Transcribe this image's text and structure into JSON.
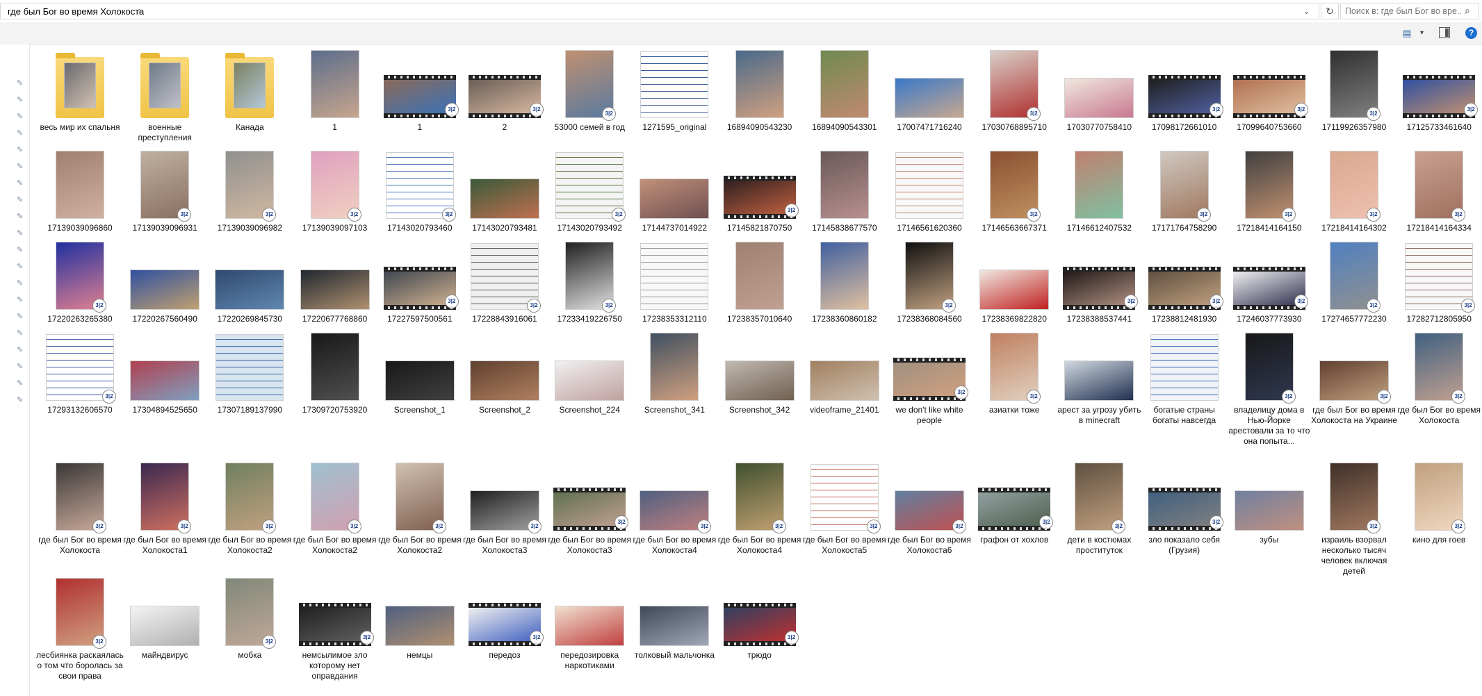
{
  "address_bar": {
    "path": "где был Бог во время Холокоста",
    "chevron": "›",
    "dropdown_icon": "chevron-down-icon",
    "refresh_icon": "refresh-icon"
  },
  "search": {
    "placeholder": "Поиск в: где был Бог во вре...",
    "icon": "search-icon"
  },
  "ribbon": {
    "view_options_icon": "view-options-icon",
    "preview_pane_icon": "preview-pane-icon",
    "help_label": "?"
  },
  "nav": {
    "pin_icon": "pin-icon",
    "pin_count": 20
  },
  "badge_text": "3|2",
  "colors": {
    "folder": "#f0c447",
    "search_border": "#d9d9d9",
    "help": "#1a6fd0"
  },
  "rows": [
    {
      "items": [
        {
          "label": "весь мир их спальня",
          "kind": "folder",
          "c1": "#6a6a70",
          "c2": "#d2c2b2"
        },
        {
          "label": "военные преступления",
          "kind": "folder",
          "c1": "#707a88",
          "c2": "#c0c0c8"
        },
        {
          "label": "Канада",
          "kind": "folder",
          "c1": "#7a8060",
          "c2": "#b4c8d8"
        },
        {
          "label": "1",
          "kind": "portrait",
          "c1": "#5d6e8c",
          "c2": "#c7a58d"
        },
        {
          "label": "1",
          "kind": "video",
          "c1": "#8a6a5a",
          "c2": "#3a72b8",
          "badge": true
        },
        {
          "label": "2",
          "kind": "video",
          "c1": "#6a5e56",
          "c2": "#d8b8a0",
          "badge": true
        },
        {
          "label": "53000 семей в год",
          "kind": "portrait",
          "c1": "#c09070",
          "c2": "#5a7aa0",
          "badge": true
        },
        {
          "label": "1271595_original",
          "kind": "doc",
          "c1": "#ffffff",
          "c2": "#3c5f9a"
        },
        {
          "label": "16894090543230",
          "kind": "portrait",
          "c1": "#4a6a8a",
          "c2": "#d0a080"
        },
        {
          "label": "16894090543301",
          "kind": "portrait",
          "c1": "#708a50",
          "c2": "#c08a70"
        },
        {
          "label": "17007471716240",
          "kind": "landscape",
          "c1": "#3a78c8",
          "c2": "#c8a890"
        },
        {
          "label": "17030768895710",
          "kind": "portrait",
          "c1": "#d8d0c8",
          "c2": "#b03030",
          "badge": true
        },
        {
          "label": "17030770758410",
          "kind": "landscape",
          "c1": "#f0e8e0",
          "c2": "#c87890"
        },
        {
          "label": "17098172661010",
          "kind": "video",
          "c1": "#202020",
          "c2": "#5060a0",
          "badge": true
        },
        {
          "label": "17099640753660",
          "kind": "video",
          "c1": "#b07050",
          "c2": "#e0c0a0",
          "badge": true
        },
        {
          "label": "17119926357980",
          "kind": "portrait",
          "c1": "#303030",
          "c2": "#808080",
          "badge": true
        },
        {
          "label": "17125733461640",
          "kind": "video",
          "c1": "#3050a0",
          "c2": "#c09070",
          "badge": true
        }
      ]
    },
    {
      "items": [
        {
          "label": "17139039096860",
          "kind": "portrait",
          "c1": "#a08070",
          "c2": "#d0b0a0"
        },
        {
          "label": "17139039096931",
          "kind": "portrait",
          "c1": "#c0b0a0",
          "c2": "#8a7060",
          "badge": true
        },
        {
          "label": "17139039096982",
          "kind": "portrait",
          "c1": "#909090",
          "c2": "#d0b8a0",
          "badge": true
        },
        {
          "label": "17139039097103",
          "kind": "portrait",
          "c1": "#e0a0c0",
          "c2": "#f0d0c0",
          "badge": true
        },
        {
          "label": "17143020793460",
          "kind": "doc",
          "c1": "#ffffff",
          "c2": "#4070c0",
          "badge": true
        },
        {
          "label": "17143020793481",
          "kind": "landscape",
          "c1": "#3a5a3a",
          "c2": "#c07050"
        },
        {
          "label": "17143020793492",
          "kind": "doc",
          "c1": "#f4f4f4",
          "c2": "#507030",
          "badge": true
        },
        {
          "label": "17144737014922",
          "kind": "landscape",
          "c1": "#c0907a",
          "c2": "#705050"
        },
        {
          "label": "17145821870750",
          "kind": "video",
          "c1": "#302020",
          "c2": "#c06040",
          "badge": true
        },
        {
          "label": "17145838677570",
          "kind": "portrait",
          "c1": "#6a5858",
          "c2": "#b89090"
        },
        {
          "label": "17146561620360",
          "kind": "doc",
          "c1": "#f8f8f8",
          "c2": "#c08060"
        },
        {
          "label": "17146563667371",
          "kind": "portrait",
          "c1": "#8a5030",
          "c2": "#c09060",
          "badge": true
        },
        {
          "label": "17146612407532",
          "kind": "portrait",
          "c1": "#c08070",
          "c2": "#80c0a0"
        },
        {
          "label": "17171764758290",
          "kind": "portrait",
          "c1": "#d0c8c0",
          "c2": "#a07860",
          "badge": true
        },
        {
          "label": "17218414164150",
          "kind": "portrait",
          "c1": "#404040",
          "c2": "#c09070",
          "badge": true
        },
        {
          "label": "17218414164302",
          "kind": "portrait",
          "c1": "#d8a890",
          "c2": "#f0c0b0",
          "badge": true
        },
        {
          "label": "17218414164334",
          "kind": "portrait",
          "c1": "#c8a090",
          "c2": "#a07060",
          "badge": true
        }
      ]
    },
    {
      "items": [
        {
          "label": "17220263265380",
          "kind": "portrait",
          "c1": "#2030a0",
          "c2": "#e08090",
          "badge": true
        },
        {
          "label": "17220267560490",
          "kind": "landscape",
          "c1": "#3050a0",
          "c2": "#c0a070"
        },
        {
          "label": "17220269845730",
          "kind": "landscape",
          "c1": "#304870",
          "c2": "#6088b0"
        },
        {
          "label": "17220677768860",
          "kind": "landscape",
          "c1": "#202830",
          "c2": "#b09070"
        },
        {
          "label": "17227597500561",
          "kind": "video",
          "c1": "#404850",
          "c2": "#d0b090",
          "badge": true
        },
        {
          "label": "17228843916061",
          "kind": "doc",
          "c1": "#f0f0f0",
          "c2": "#505050",
          "badge": true
        },
        {
          "label": "17233419226750",
          "kind": "portrait",
          "c1": "#202020",
          "c2": "#e0e0e0",
          "badge": true
        },
        {
          "label": "17238353312110",
          "kind": "doc",
          "c1": "#f8f8f8",
          "c2": "#909090"
        },
        {
          "label": "17238357010640",
          "kind": "portrait",
          "c1": "#a08070",
          "c2": "#c0a090"
        },
        {
          "label": "17238360860182",
          "kind": "portrait",
          "c1": "#4060a0",
          "c2": "#e0c0a0"
        },
        {
          "label": "17238368084560",
          "kind": "portrait",
          "c1": "#101010",
          "c2": "#c0a080",
          "badge": true
        },
        {
          "label": "17238369822820",
          "kind": "landscape",
          "c1": "#f0e8e0",
          "c2": "#c02020"
        },
        {
          "label": "17238388537441",
          "kind": "video",
          "c1": "#201818",
          "c2": "#b09080",
          "badge": true
        },
        {
          "label": "17238812481930",
          "kind": "video",
          "c1": "#605040",
          "c2": "#c0a080",
          "badge": true
        },
        {
          "label": "17246037773930",
          "kind": "video",
          "c1": "#f0f0f0",
          "c2": "#303050",
          "badge": true
        },
        {
          "label": "17274657772230",
          "kind": "portrait",
          "c1": "#5080c0",
          "c2": "#909090",
          "badge": true
        },
        {
          "label": "17282712805950",
          "kind": "doc",
          "c1": "#f8f8f8",
          "c2": "#806050",
          "badge": true
        }
      ]
    },
    {
      "items": [
        {
          "label": "17293132606570",
          "kind": "doc",
          "c1": "#ffffff",
          "c2": "#3050a0",
          "badge": true
        },
        {
          "label": "17304894525650",
          "kind": "landscape",
          "c1": "#b04050",
          "c2": "#80a0c0"
        },
        {
          "label": "17307189137990",
          "kind": "doc",
          "c1": "#d8e4f0",
          "c2": "#3060a0"
        },
        {
          "label": "17309720753920",
          "kind": "portrait",
          "c1": "#181818",
          "c2": "#505050"
        },
        {
          "label": "Screenshot_1",
          "kind": "landscape",
          "c1": "#181818",
          "c2": "#404040"
        },
        {
          "label": "Screenshot_2",
          "kind": "landscape",
          "c1": "#604030",
          "c2": "#b08060"
        },
        {
          "label": "Screenshot_224",
          "kind": "landscape",
          "c1": "#f0f0f0",
          "c2": "#c0a0a0"
        },
        {
          "label": "Screenshot_341",
          "kind": "portrait",
          "c1": "#405060",
          "c2": "#d0a080"
        },
        {
          "label": "Screenshot_342",
          "kind": "landscape",
          "c1": "#c0b8b0",
          "c2": "#706050"
        },
        {
          "label": "videoframe_21401",
          "kind": "landscape",
          "c1": "#a08060",
          "c2": "#d0c0b0"
        },
        {
          "label": "we don't like white people",
          "kind": "video",
          "c1": "#a09080",
          "c2": "#d0a080",
          "badge": true
        },
        {
          "label": "азиатки тоже",
          "kind": "portrait",
          "c1": "#c08060",
          "c2": "#e0d0c0",
          "badge": true
        },
        {
          "label": "арест за угрозу убить в minecraft",
          "kind": "landscape",
          "c1": "#d0d8e0",
          "c2": "#203050"
        },
        {
          "label": "богатые страны богаты навсегда",
          "kind": "doc",
          "c1": "#f0f4f8",
          "c2": "#3060b0"
        },
        {
          "label": "владелицу дома в Нью-Йорке арестовали за то что она попыта...",
          "kind": "portrait",
          "c1": "#181818",
          "c2": "#303850",
          "badge": true
        },
        {
          "label": "где был Бог во время Холокоста на Украине",
          "kind": "landscape",
          "c1": "#604030",
          "c2": "#c0a080",
          "badge": true
        },
        {
          "label": "где был Бог во время Холокоста",
          "kind": "portrait",
          "c1": "#406080",
          "c2": "#c0a090",
          "badge": true
        }
      ]
    },
    {
      "items": [
        {
          "label": "где был Бог во время Холокоста",
          "kind": "portrait",
          "c1": "#3a3838",
          "c2": "#c8a898",
          "badge": true
        },
        {
          "label": "где был Бог во время Холокоста1",
          "kind": "portrait",
          "c1": "#3a2850",
          "c2": "#d07060",
          "badge": true
        },
        {
          "label": "где был Бог во время Холокоста2",
          "kind": "portrait",
          "c1": "#708060",
          "c2": "#c0a080",
          "badge": true
        },
        {
          "label": "где был Бог во время Холокоста2",
          "kind": "portrait",
          "c1": "#a0c0d0",
          "c2": "#d0a0b0",
          "badge": true
        },
        {
          "label": "где был Бог во время Холокоста2",
          "kind": "portrait",
          "c1": "#d0c0b0",
          "c2": "#806050",
          "badge": true
        },
        {
          "label": "где был Бог во время Холокоста3",
          "kind": "landscape",
          "c1": "#202020",
          "c2": "#a0a0a0",
          "badge": true
        },
        {
          "label": "где был Бог во время Холокоста3",
          "kind": "video",
          "c1": "#607050",
          "c2": "#c0a090",
          "badge": true
        },
        {
          "label": "где был Бог во время Холокоста4",
          "kind": "landscape",
          "c1": "#506080",
          "c2": "#c08080",
          "badge": true
        },
        {
          "label": "где был Бог во время Холокоста4",
          "kind": "portrait",
          "c1": "#405030",
          "c2": "#c0a070",
          "badge": true
        },
        {
          "label": "где был Бог во время Холокоста5",
          "kind": "doc",
          "c1": "#ffffff",
          "c2": "#c06050",
          "badge": true
        },
        {
          "label": "где был Бог во время Холокоста6",
          "kind": "landscape",
          "c1": "#6080a0",
          "c2": "#c05050",
          "badge": true
        },
        {
          "label": "графон от хохлов",
          "kind": "video",
          "c1": "#90a0a0",
          "c2": "#506050",
          "badge": true
        },
        {
          "label": "дети в костюмах проституток",
          "kind": "portrait",
          "c1": "#605040",
          "c2": "#c0a080",
          "badge": true
        },
        {
          "label": "зло показало себя (Грузия)",
          "kind": "video",
          "c1": "#406080",
          "c2": "#808080",
          "badge": true
        },
        {
          "label": "зубы",
          "kind": "landscape",
          "c1": "#7080a0",
          "c2": "#c09080"
        },
        {
          "label": "израиль взорвал несколько тысяч человек включая детей",
          "kind": "portrait",
          "c1": "#403028",
          "c2": "#a07860",
          "badge": true
        },
        {
          "label": "кино для гоев",
          "kind": "portrait",
          "c1": "#c0a080",
          "c2": "#f0d8c0",
          "badge": true
        }
      ]
    },
    {
      "items": [
        {
          "label": "лесбиянка раскаялась о том что боролась за свои права",
          "kind": "portrait",
          "c1": "#b03030",
          "c2": "#d0a080",
          "badge": true
        },
        {
          "label": "майндвирус",
          "kind": "landscape",
          "c1": "#f4f4f4",
          "c2": "#b0b0b0"
        },
        {
          "label": "мобка",
          "kind": "portrait",
          "c1": "#808878",
          "c2": "#c0a898",
          "badge": true
        },
        {
          "label": "немсылимое зло которому нет оправдания",
          "kind": "video",
          "c1": "#202020",
          "c2": "#606060",
          "badge": true
        },
        {
          "label": "немцы",
          "kind": "landscape",
          "c1": "#506080",
          "c2": "#b09070"
        },
        {
          "label": "передоз",
          "kind": "video",
          "c1": "#f0f0f0",
          "c2": "#4060c0",
          "badge": true
        },
        {
          "label": "передозировка наркотиками",
          "kind": "landscape",
          "c1": "#f0e0d0",
          "c2": "#c04040"
        },
        {
          "label": "толковый мальчонка",
          "kind": "landscape",
          "c1": "#404858",
          "c2": "#a0a8b8"
        },
        {
          "label": "трюдо",
          "kind": "video",
          "c1": "#304060",
          "c2": "#c03030",
          "badge": true
        }
      ]
    }
  ]
}
